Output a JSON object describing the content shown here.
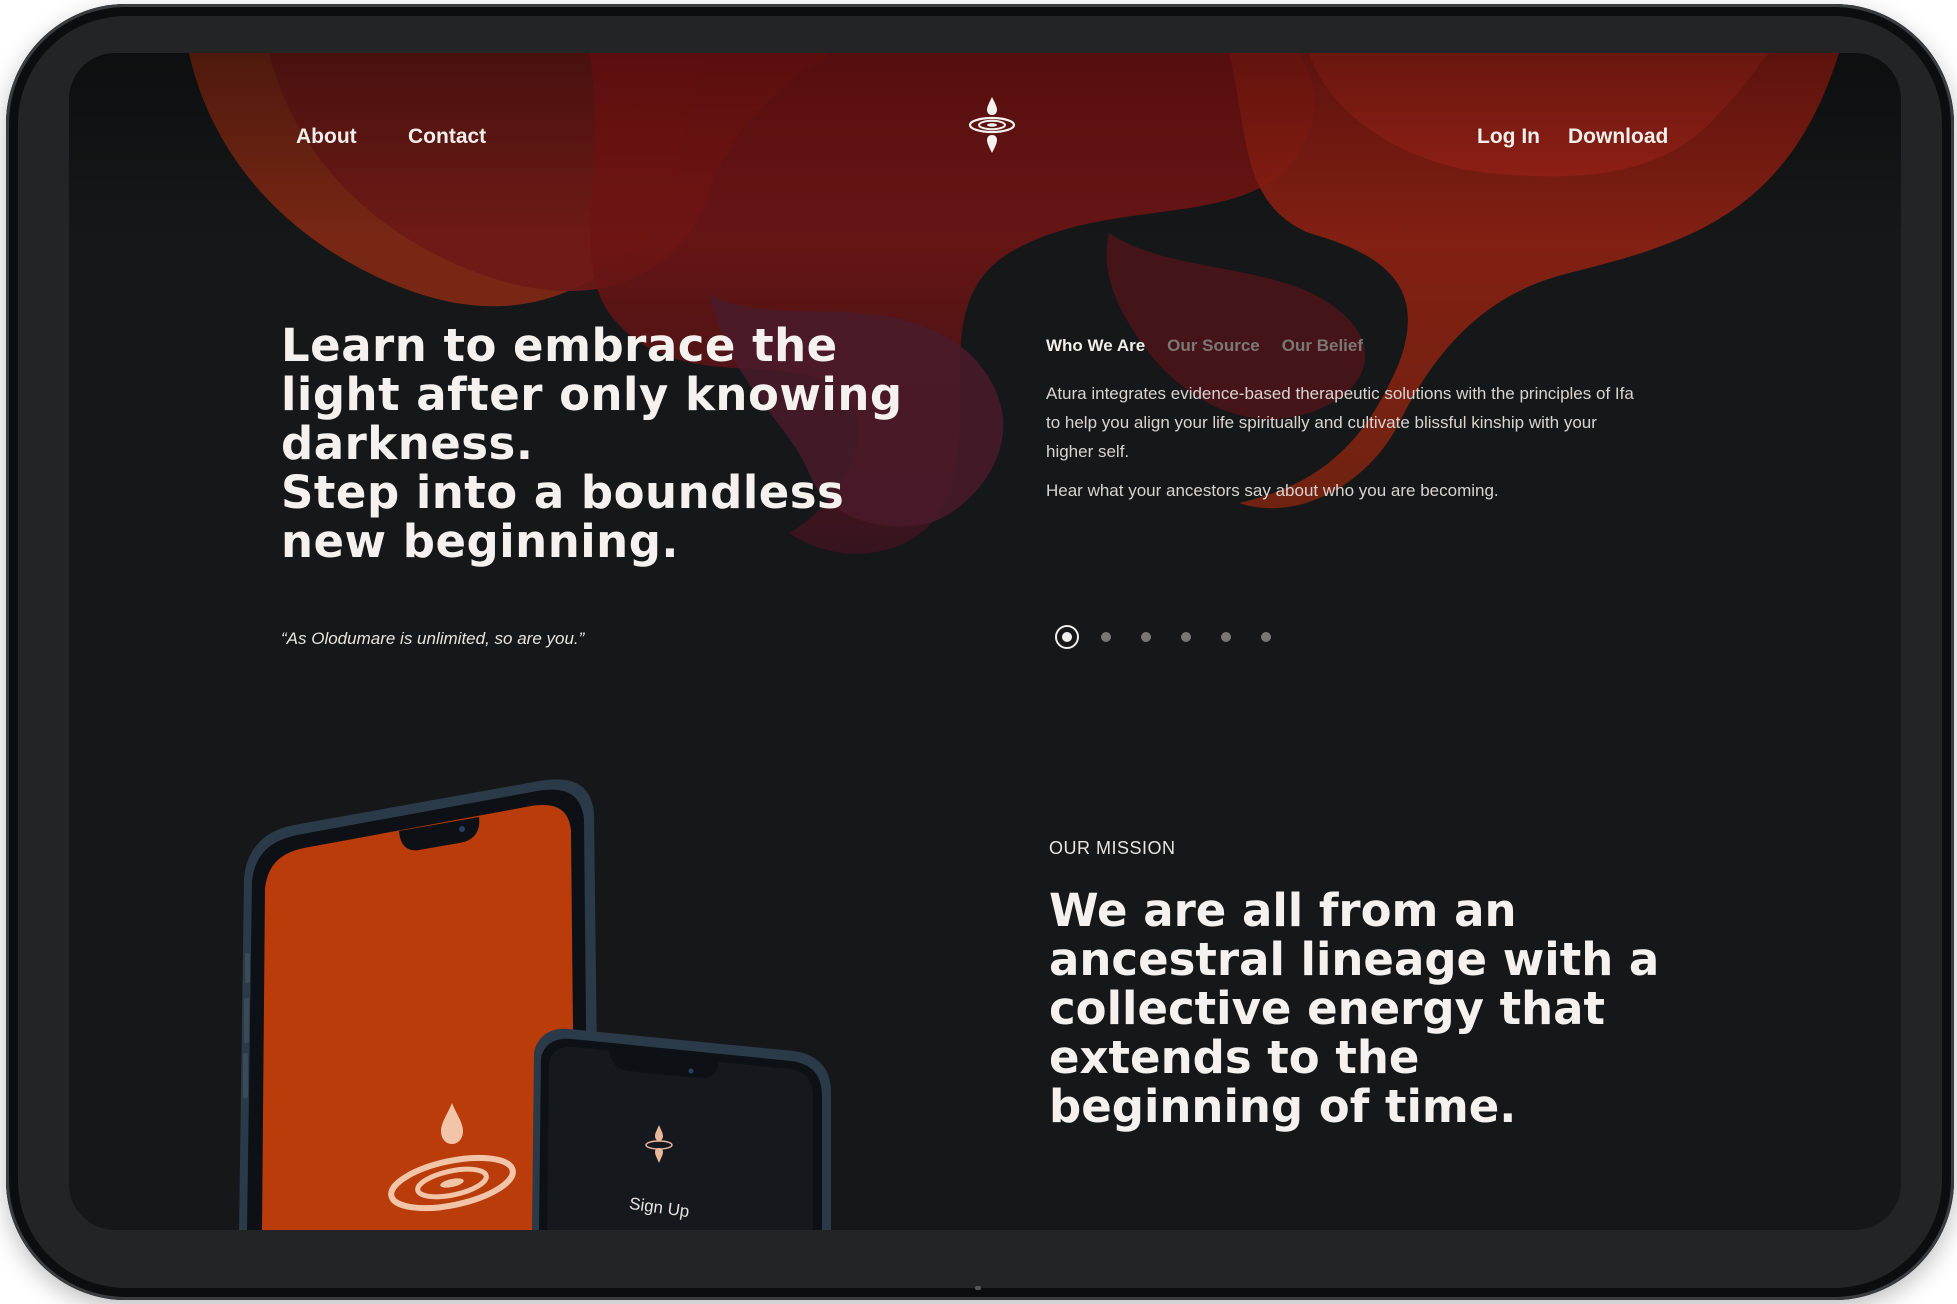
{
  "nav": {
    "left": [
      {
        "label": "About"
      },
      {
        "label": "Contact"
      }
    ],
    "right": [
      {
        "label": "Log In"
      },
      {
        "label": "Download"
      }
    ]
  },
  "hero": {
    "lines": [
      "Learn to embrace the",
      "light after only knowing",
      "darkness.",
      "Step into a boundless",
      "new beginning."
    ],
    "quote": "“As Olodumare is unlimited, so are you.”"
  },
  "tabs": [
    {
      "label": "Who We Are",
      "active": true
    },
    {
      "label": "Our Source",
      "active": false
    },
    {
      "label": "Our Belief",
      "active": false
    }
  ],
  "about": {
    "paragraph1": "Atura integrates evidence-based therapeutic solutions with the principles of Ifa to help you align your life spiritually and cultivate blissful kinship with your higher self.",
    "paragraph2": "Hear what your ancestors say about who you are becoming."
  },
  "carousel": {
    "total": 6,
    "active_index": 0
  },
  "mission": {
    "label": "OUR MISSION",
    "lines": [
      "We are all from an",
      "ancestral lineage with a",
      "collective energy that",
      "extends to the",
      "beginning of time."
    ]
  },
  "phone_small": {
    "signup_label": "Sign Up"
  },
  "icons": {
    "logo": "atura-drop-ripple-icon"
  },
  "colors": {
    "background": "#151718",
    "accent_red": "#8a1a18",
    "accent_orange": "#c2410c",
    "text": "#f4f1ee",
    "muted_tab": "#7c7774"
  }
}
